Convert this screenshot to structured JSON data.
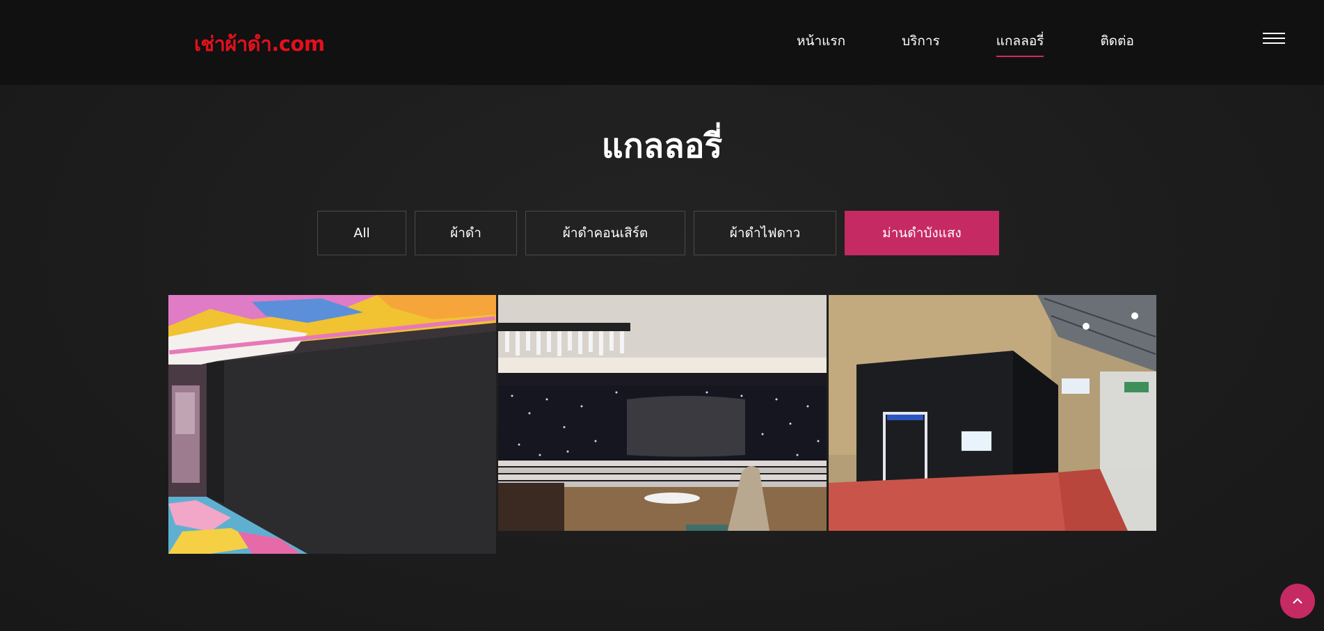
{
  "header": {
    "logo": "เช่าผ้าดำ.com",
    "nav": [
      {
        "label": "หน้าแรก"
      },
      {
        "label": "บริการ"
      },
      {
        "label": "แกลลอรี่"
      },
      {
        "label": "ติดต่อ"
      }
    ],
    "active_nav": "แกลลอรี่"
  },
  "page": {
    "title": "แกลลอรี่"
  },
  "filters": [
    {
      "label": "All"
    },
    {
      "label": "ผ้าดำ"
    },
    {
      "label": "ผ้าดำคอนเสิร์ต"
    },
    {
      "label": "ผ้าดำไฟดาว"
    },
    {
      "label": "ม่านดำบังแสง"
    }
  ],
  "active_filter": "ม่านดำบังแสง",
  "colors": {
    "logo": "#e3101d",
    "accent": "#c62a63",
    "header_bg": "#111111",
    "page_bg": "#1c1c1c"
  },
  "icons": {
    "menu": "hamburger-icon",
    "scroll_top": "chevron-up-icon"
  }
}
